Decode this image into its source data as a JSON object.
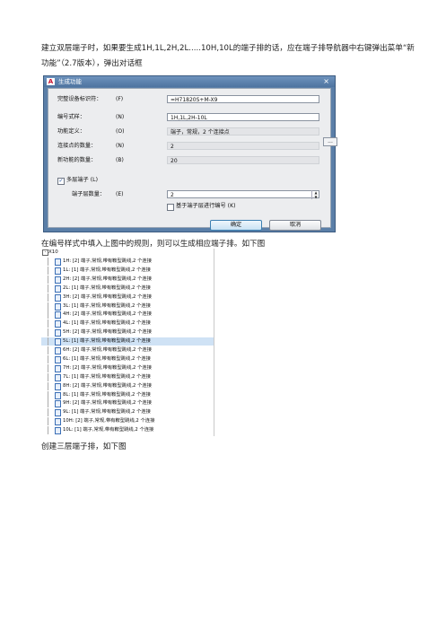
{
  "paragraphs": {
    "intro": "建立双层端子时，如果要生成1H,1L,2H,2L.....10H,10L的端子排的话，应在端子排导航器中右键弹出菜单“新功能”（2.7版本），弹出对话框",
    "after_dialog": "在编号样式中填入上图中的规则，则可以生成相应端子排。如下图",
    "after_tree": "创建三层端子排，如下图"
  },
  "dialog": {
    "title": "生成功能",
    "close": "×",
    "app_icon": "A",
    "fields": [
      {
        "label": "完整设备标识符：",
        "key": "(F)",
        "value": "=H71820S+M-X9",
        "style": "input"
      },
      {
        "label": "编号式样：",
        "key": "(N)",
        "value": "1H,1L,2H-10L",
        "style": "input"
      },
      {
        "label": "功能定义：",
        "key": "(O)",
        "value": "端子，常规，2 个连接点",
        "style": "ro"
      },
      {
        "label": "连接点的数量：",
        "key": "(N)",
        "value": "2",
        "style": "ro"
      },
      {
        "label": "新功能的数量：",
        "key": "(B)",
        "value": "20",
        "style": "ro"
      }
    ],
    "multi_layer": {
      "label": "多层端子",
      "key": "(L)",
      "checked": true
    },
    "layer_count": {
      "label": "端子层数量：",
      "key": "(E)",
      "value": "2"
    },
    "renumber": {
      "label": "基于端子层进行编号",
      "key": "(K)",
      "checked": false
    },
    "dots_button": "...",
    "ok_label": "确定",
    "cancel_label": "取消"
  },
  "tree": {
    "root_label": "X10",
    "root_toggle": "-",
    "rows": [
      {
        "prefix": "1H:",
        "count": "[2]",
        "desc": "端子,常规,带有鞍型跳线,2 个连接"
      },
      {
        "prefix": "1L:",
        "count": "[1]",
        "desc": "端子,常规,带有鞍型跳线,2 个连接"
      },
      {
        "prefix": "2H:",
        "count": "[2]",
        "desc": "端子,常规,带有鞍型跳线,2 个连接"
      },
      {
        "prefix": "2L:",
        "count": "[1]",
        "desc": "端子,常规,带有鞍型跳线,2 个连接"
      },
      {
        "prefix": "3H:",
        "count": "[2]",
        "desc": "端子,常规,带有鞍型跳线,2 个连接"
      },
      {
        "prefix": "3L:",
        "count": "[1]",
        "desc": "端子,常规,带有鞍型跳线,2 个连接"
      },
      {
        "prefix": "4H:",
        "count": "[2]",
        "desc": "端子,常规,带有鞍型跳线,2 个连接"
      },
      {
        "prefix": "4L:",
        "count": "[1]",
        "desc": "端子,常规,带有鞍型跳线,2 个连接"
      },
      {
        "prefix": "5H:",
        "count": "[2]",
        "desc": "端子,常规,带有鞍型跳线,2 个连接"
      },
      {
        "prefix": "5L:",
        "count": "[1]",
        "desc": "端子,常规,带有鞍型跳线,2 个连接",
        "selected": true
      },
      {
        "prefix": "6H:",
        "count": "[2]",
        "desc": "端子,常规,带有鞍型跳线,2 个连接"
      },
      {
        "prefix": "6L:",
        "count": "[1]",
        "desc": "端子,常规,带有鞍型跳线,2 个连接"
      },
      {
        "prefix": "7H:",
        "count": "[2]",
        "desc": "端子,常规,带有鞍型跳线,2 个连接"
      },
      {
        "prefix": "7L:",
        "count": "[1]",
        "desc": "端子,常规,带有鞍型跳线,2 个连接"
      },
      {
        "prefix": "8H:",
        "count": "[2]",
        "desc": "端子,常规,带有鞍型跳线,2 个连接"
      },
      {
        "prefix": "8L:",
        "count": "[1]",
        "desc": "端子,常规,带有鞍型跳线,2 个连接"
      },
      {
        "prefix": "9H:",
        "count": "[2]",
        "desc": "端子,常规,带有鞍型跳线,2 个连接"
      },
      {
        "prefix": "9L:",
        "count": "[1]",
        "desc": "端子,常规,带有鞍型跳线,2 个连接"
      },
      {
        "prefix": "10H:",
        "count": "[2]",
        "desc": "端子,常规,带有鞍型跳线,2 个连接"
      },
      {
        "prefix": "10L:",
        "count": "[1]",
        "desc": "端子,常规,带有鞍型跳线,2 个连接"
      }
    ]
  }
}
